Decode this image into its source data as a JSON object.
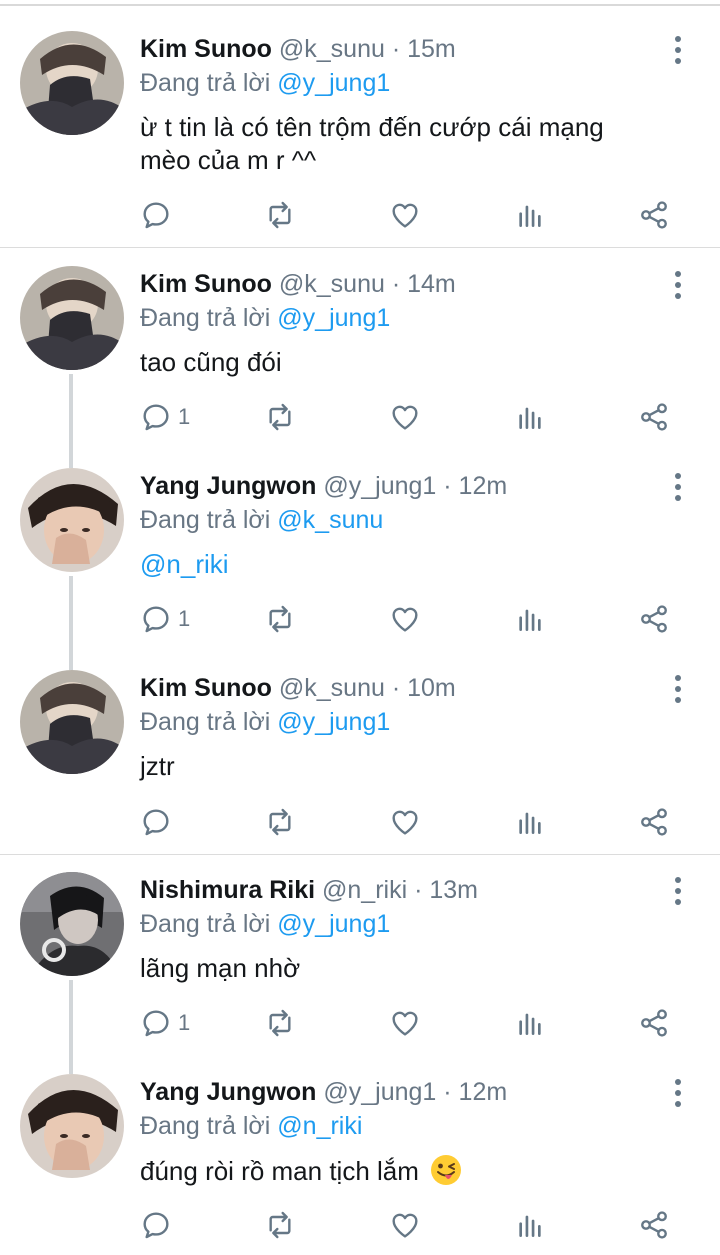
{
  "labels": {
    "replying_prefix": "Đang trả lời",
    "dot": "·"
  },
  "tweets": [
    {
      "name": "Kim Sunoo",
      "handle": "@k_sunu",
      "time": "15m",
      "reply_to": "@y_jung1",
      "text_lines": [
        "ừ t tin là có tên trộm đến cướp cái mạng",
        "mèo của m r ^^"
      ],
      "reply_count": "",
      "avatar": "sunoo"
    },
    {
      "name": "Kim Sunoo",
      "handle": "@k_sunu",
      "time": "14m",
      "reply_to": "@y_jung1",
      "text_lines": [
        "tao cũng đói"
      ],
      "reply_count": "1",
      "avatar": "sunoo"
    },
    {
      "name": "Yang Jungwon",
      "handle": "@y_jung1",
      "time": "12m",
      "reply_to": "@k_sunu",
      "text_lines": [
        "@n_riki"
      ],
      "reply_count": "1",
      "avatar": "jungwon"
    },
    {
      "name": "Kim Sunoo",
      "handle": "@k_sunu",
      "time": "10m",
      "reply_to": "@y_jung1",
      "text_lines": [
        "jztr"
      ],
      "reply_count": "",
      "avatar": "sunoo"
    },
    {
      "name": "Nishimura Riki",
      "handle": "@n_riki",
      "time": "13m",
      "reply_to": "@y_jung1",
      "text_lines": [
        "lãng mạn nhờ"
      ],
      "reply_count": "1",
      "avatar": "riki"
    },
    {
      "name": "Yang Jungwon",
      "handle": "@y_jung1",
      "time": "12m",
      "reply_to": "@n_riki",
      "text_lines": [
        "đúng ròi rồ man tịch lắm"
      ],
      "reply_count": "",
      "avatar": "jungwon"
    }
  ],
  "icons": {
    "reply": "reply-icon",
    "retweet": "retweet-icon",
    "like": "heart-icon",
    "stats": "stats-icon",
    "share": "share-icon",
    "more": "more-vertical-icon"
  },
  "colors": {
    "mention": "#1d9bf0",
    "muted": "#687684",
    "icon": "#657786"
  }
}
